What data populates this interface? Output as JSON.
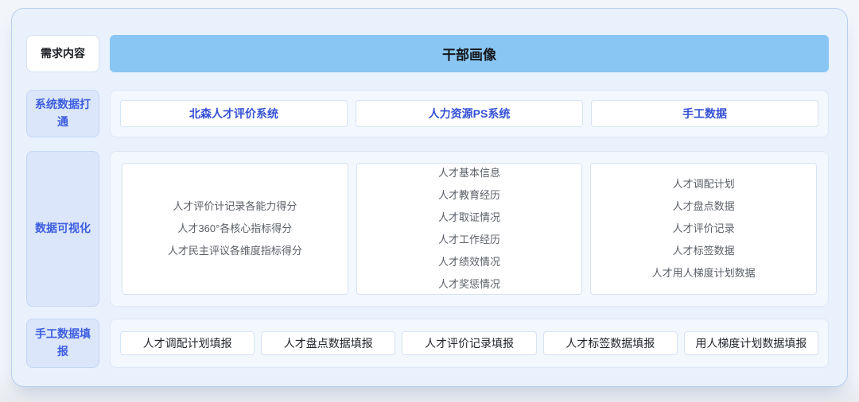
{
  "header": {
    "label": "需求内容",
    "title": "干部画像"
  },
  "row_systems": {
    "label": "系统数据打通",
    "items": [
      "北森人才评价系统",
      "人力资源PS系统",
      "手工数据"
    ]
  },
  "row_visualization": {
    "label": "数据可视化",
    "groups": [
      {
        "lines": [
          "人才评价计记录各能力得分",
          "人才360°各核心指标得分",
          "人才民主评议各维度指标得分"
        ]
      },
      {
        "lines": [
          "人才基本信息",
          "人才教育经历",
          "人才取证情况",
          "人才工作经历",
          "人才绩效情况",
          "人才奖惩情况"
        ]
      },
      {
        "lines": [
          "人才调配计划",
          "人才盘点数据",
          "人才评价记录",
          "人才标签数据",
          "人才用人梯度计划数据"
        ]
      }
    ]
  },
  "row_manual": {
    "label": "手工数据填报",
    "items": [
      "人才调配计划填报",
      "人才盘点数据填报",
      "人才评价记录填报",
      "人才标签数据填报",
      "用人梯度计划数据填报"
    ]
  },
  "colors": {
    "card_background": "#e9f1fd",
    "card_border": "#b9cff2",
    "banner_background": "#89c6f3",
    "label_background": "#dbe6fa",
    "label_text": "#3d5de0",
    "system_item_text": "#3450d4",
    "list_text": "#5a5f67",
    "dark_text": "#1c1f24"
  }
}
